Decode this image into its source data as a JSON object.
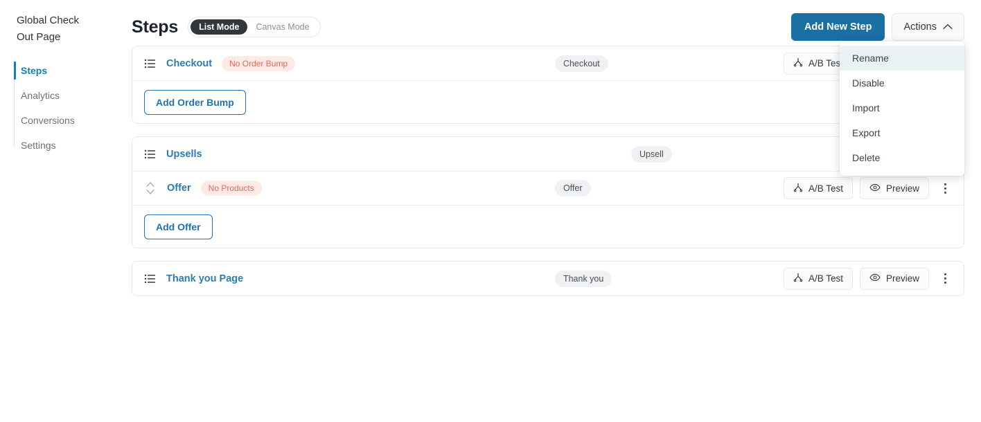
{
  "sidebar": {
    "title": "Global Check Out Page",
    "items": [
      {
        "label": "Steps",
        "active": true
      },
      {
        "label": "Analytics",
        "active": false
      },
      {
        "label": "Conversions",
        "active": false
      },
      {
        "label": "Settings",
        "active": false
      }
    ]
  },
  "header": {
    "page_title": "Steps",
    "mode_list": "List Mode",
    "mode_canvas": "Canvas Mode",
    "add_new_step": "Add New Step",
    "actions": "Actions",
    "actions_chevron": "chevron-up-icon",
    "accent_color": "#1a6fa3"
  },
  "actions_menu": {
    "open": true,
    "items": [
      {
        "label": "Rename",
        "highlighted": true
      },
      {
        "label": "Disable",
        "highlighted": false
      },
      {
        "label": "Import",
        "highlighted": false
      },
      {
        "label": "Export",
        "highlighted": false
      },
      {
        "label": "Delete",
        "highlighted": false
      }
    ]
  },
  "buttons": {
    "ab_test": "A/B Test",
    "preview": "Preview",
    "kebab": "more-options-icon"
  },
  "cards": [
    {
      "id": "checkout-card",
      "rows": [
        {
          "name": "Checkout",
          "badge": "No Order Bump",
          "type": "Checkout",
          "has_ab_test": true,
          "has_preview": true
        }
      ],
      "footer_button": "Add Order Bump"
    },
    {
      "id": "upsells-card",
      "rows": [
        {
          "name": "Upsells",
          "badge": "",
          "type": "Upsell",
          "has_ab_test": false,
          "has_preview": true
        },
        {
          "name": "Offer",
          "badge": "No Products",
          "type": "Offer",
          "has_ab_test": true,
          "has_preview": true
        }
      ],
      "footer_button": "Add Offer"
    },
    {
      "id": "thankyou-card",
      "rows": [
        {
          "name": "Thank you Page",
          "badge": "",
          "type": "Thank you",
          "has_ab_test": true,
          "has_preview": true
        }
      ],
      "footer_button": ""
    }
  ],
  "annotation": {
    "arrow_color": "#fb0007",
    "arrow_name": "red-arrow-annotation"
  }
}
